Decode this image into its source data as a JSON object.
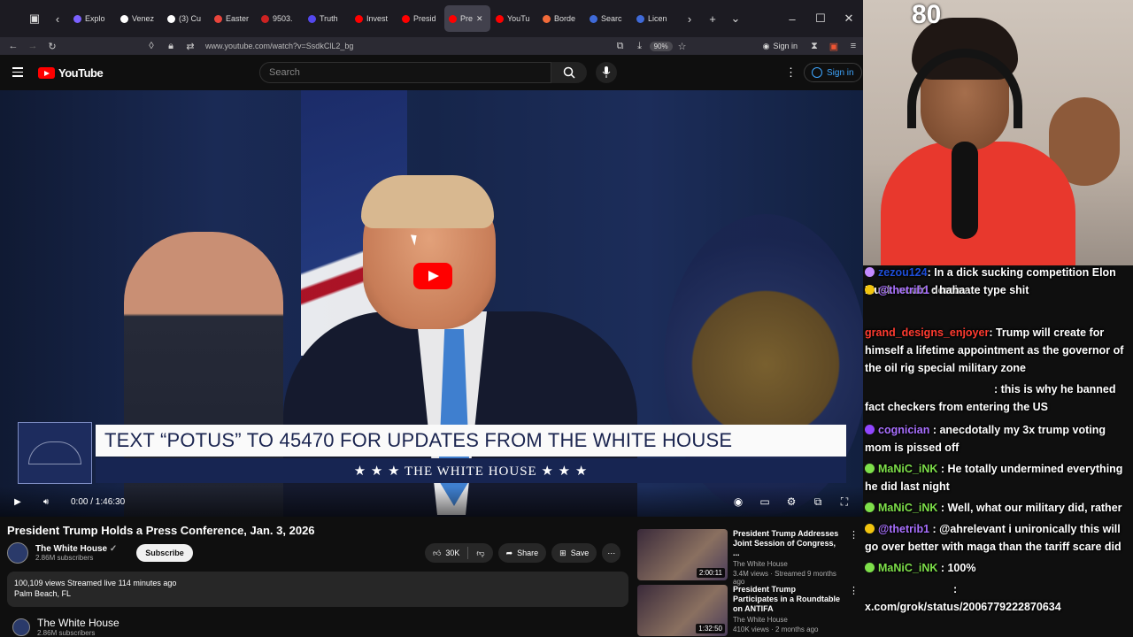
{
  "browser": {
    "tabs": [
      {
        "label": "Explo",
        "color": "#7b61ff",
        "active": false
      },
      {
        "label": "Venez",
        "color": "#ffffff",
        "active": false
      },
      {
        "label": "(3) Cu",
        "color": "#ffffff",
        "active": false
      },
      {
        "label": "Easter",
        "color": "#e8453c",
        "active": false
      },
      {
        "label": "9503.",
        "color": "#cc2222",
        "active": false
      },
      {
        "label": "Truth",
        "color": "#5448ee",
        "active": false
      },
      {
        "label": "Invest",
        "color": "#ff0000",
        "active": false
      },
      {
        "label": "Presid",
        "color": "#ff0000",
        "active": false
      },
      {
        "label": "Pre",
        "color": "#ff0000",
        "active": true
      },
      {
        "label": "YouTu",
        "color": "#ff0000",
        "active": false
      },
      {
        "label": "Borde",
        "color": "#f26b3a",
        "active": false
      },
      {
        "label": "Searc",
        "color": "#3f6ad8",
        "active": false
      },
      {
        "label": "Licen",
        "color": "#3f6ad8",
        "active": false
      }
    ],
    "url": "www.youtube.com/watch?v=SsdkClL2_bg",
    "zoom": "90%",
    "signin": "Sign in"
  },
  "youtube": {
    "logo_text": "YouTube",
    "search_placeholder": "Search",
    "signin": "Sign in",
    "video": {
      "banner_text": "TEXT “POTUS” TO 45470 FOR UPDATES FROM THE WHITE HOUSE",
      "banner_sub": "★ ★ ★  THE WHITE HOUSE  ★ ★ ★",
      "time": "0:00 / 1:46:30"
    },
    "title": "President Trump Holds a Press Conference, Jan. 3, 2026",
    "channel": {
      "name": "The White House",
      "subs": "2.86M subscribers"
    },
    "subscribe": "Subscribe",
    "likes": "30K",
    "share": "Share",
    "save": "Save",
    "stats": "100,109 views  Streamed live 114 minutes ago",
    "location": "Palm Beach, FL",
    "bottom_channel": "The White House",
    "bottom_subs": "2.86M subscribers",
    "recs": [
      {
        "title": "President Trump Addresses Joint Session of Congress, ...",
        "channel": "The White House",
        "views": "3.4M views · Streamed 9 months ago",
        "duration": "2:00:11"
      },
      {
        "title": "President Trump Participates in a Roundtable on ANTIFA",
        "channel": "The White House",
        "views": "410K views · 2 months ago",
        "duration": "1:32:50"
      }
    ]
  },
  "stream": {
    "counter": "80",
    "chat": [
      {
        "user": "zezou124",
        "text": ": In a dick sucking competition Elon Musk would dominate type shit",
        "color": "#1e4ed8",
        "badge": "#c38bff"
      },
      {
        "user": "@thetrib1",
        "text": " : haha",
        "color": "#a970ff",
        "badge": "#f1c40f"
      },
      {
        "user": "grand_designs_enjoyer",
        "text": ": Trump will create for himself a lifetime appointment as the governor of the oil rig special military zone",
        "color": "#ff3b30",
        "badge": ""
      },
      {
        "user": "",
        "text": ": this is why he banned fact checkers from entering the US",
        "color": "#ffffff",
        "badge": ""
      },
      {
        "user": "cognician",
        "text": " : anecdotally my 3x trump voting mom is pissed off",
        "color": "#a970ff",
        "badge": "#9146ff"
      },
      {
        "user": "MaNiC_iNK",
        "text": " : He totally undermined everything he did last night",
        "color": "#7ee04a",
        "badge": "#7ee04a"
      },
      {
        "user": "MaNiC_iNK",
        "text": " : Well, what our military did, rather",
        "color": "#7ee04a",
        "badge": "#7ee04a"
      },
      {
        "user": "@thetrib1",
        "text": " : @ahrelevant i unironically this will go over better with maga than the tariff scare did",
        "color": "#a970ff",
        "badge": "#f1c40f"
      },
      {
        "user": "MaNiC_iNK",
        "text": " : 100%",
        "color": "#7ee04a",
        "badge": "#7ee04a"
      },
      {
        "user": "",
        "text": ":",
        "color": "#ffffff",
        "badge": ""
      },
      {
        "user": "",
        "text": "x.com/grok/status/2006779222870634",
        "color": "#ffffff",
        "badge": ""
      }
    ]
  }
}
